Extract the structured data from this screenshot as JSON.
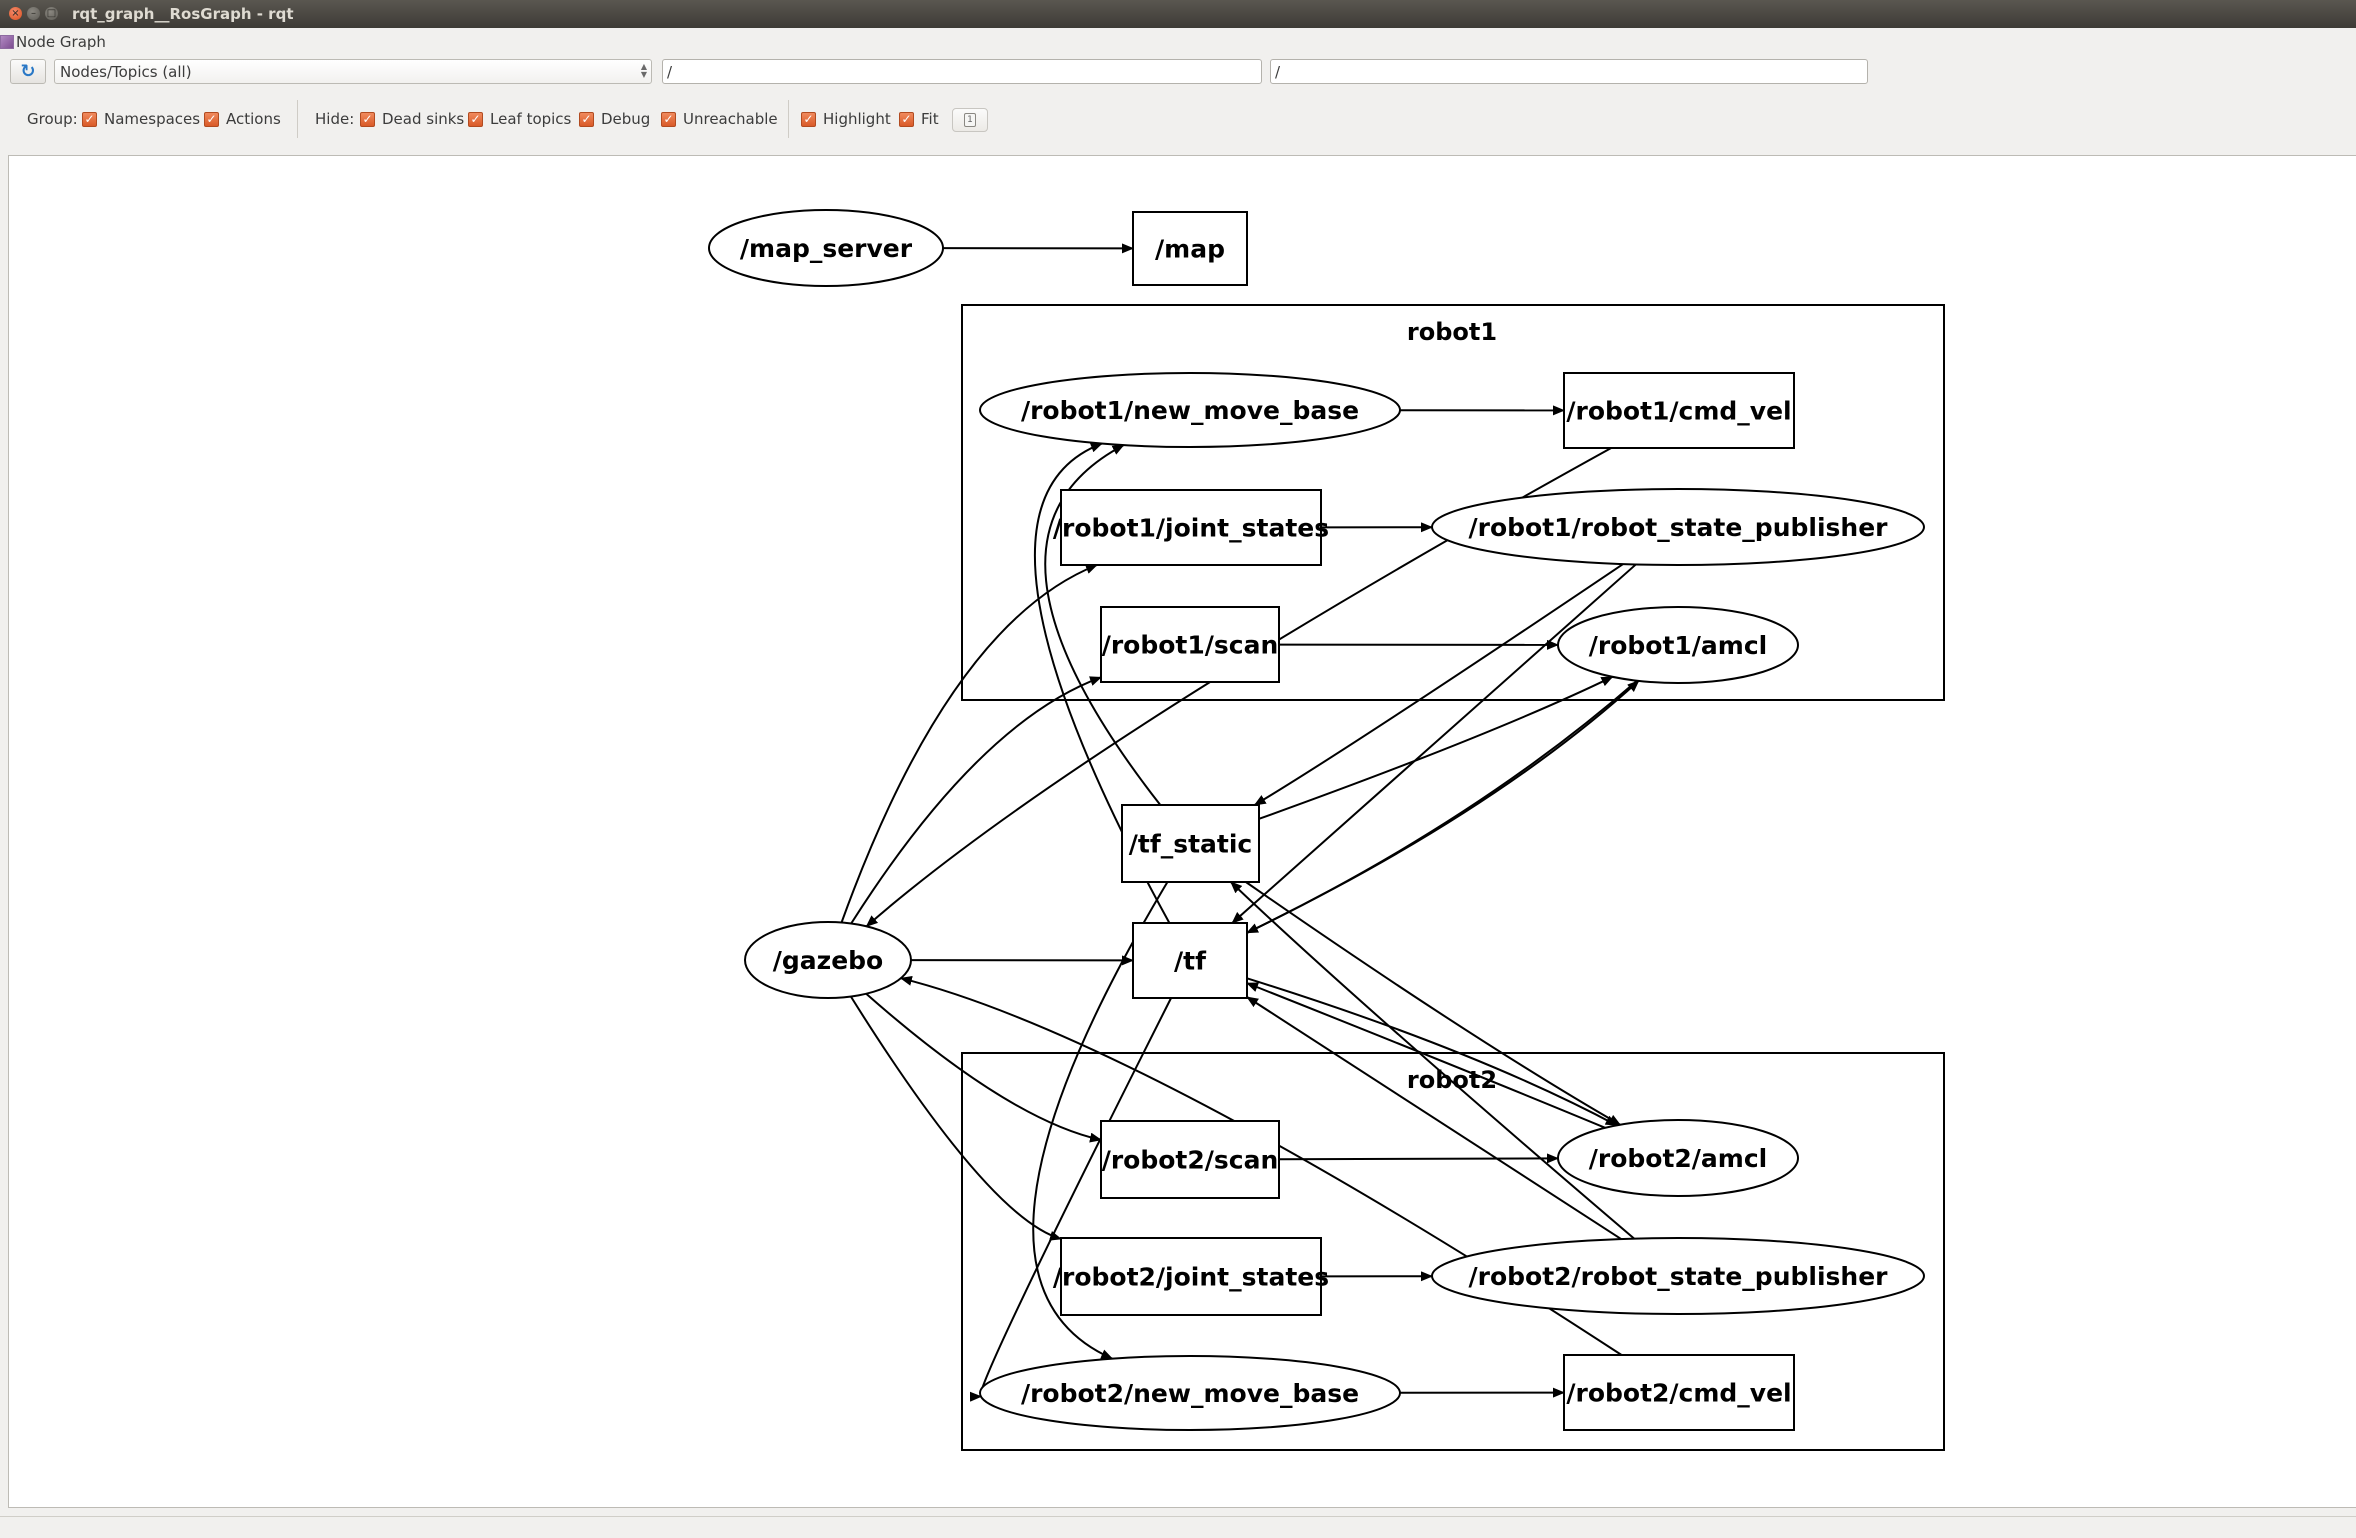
{
  "window": {
    "title": "rqt_graph__RosGraph - rqt",
    "buttons": [
      "close",
      "minimize",
      "maximize"
    ]
  },
  "plugin": {
    "title": "Node Graph",
    "icon": "node-graph-icon"
  },
  "controls": {
    "refresh_icon": "refresh-icon",
    "graph_type": "Nodes/Topics (all)",
    "namespace_filter": "/",
    "topic_filter": "/"
  },
  "options": {
    "group_label": "Group:",
    "group": [
      {
        "label": "Namespaces",
        "checked": true
      },
      {
        "label": "Actions",
        "checked": true
      }
    ],
    "hide_label": "Hide:",
    "hide": [
      {
        "label": "Dead sinks",
        "checked": true
      },
      {
        "label": "Leaf topics",
        "checked": true
      },
      {
        "label": "Debug",
        "checked": true
      },
      {
        "label": "Unreachable",
        "checked": true
      }
    ],
    "view": [
      {
        "label": "Highlight",
        "checked": true
      },
      {
        "label": "Fit",
        "checked": true
      }
    ],
    "save_icon": "save-as-image-icon"
  },
  "graph": {
    "clusters": [
      {
        "id": "robot1",
        "label": "robot1"
      },
      {
        "id": "robot2",
        "label": "robot2"
      }
    ],
    "nodes": [
      {
        "id": "map_server",
        "label": "/map_server",
        "kind": "node"
      },
      {
        "id": "map",
        "label": "/map",
        "kind": "topic"
      },
      {
        "id": "r1_nmb",
        "label": "/robot1/new_move_base",
        "kind": "node",
        "cluster": "robot1"
      },
      {
        "id": "r1_cmd",
        "label": "/robot1/cmd_vel",
        "kind": "topic",
        "cluster": "robot1"
      },
      {
        "id": "r1_js",
        "label": "/robot1/joint_states",
        "kind": "topic",
        "cluster": "robot1"
      },
      {
        "id": "r1_rsp",
        "label": "/robot1/robot_state_publisher",
        "kind": "node",
        "cluster": "robot1"
      },
      {
        "id": "r1_scan",
        "label": "/robot1/scan",
        "kind": "topic",
        "cluster": "robot1"
      },
      {
        "id": "r1_amcl",
        "label": "/robot1/amcl",
        "kind": "node",
        "cluster": "robot1"
      },
      {
        "id": "tf_static",
        "label": "/tf_static",
        "kind": "topic"
      },
      {
        "id": "tf",
        "label": "/tf",
        "kind": "topic"
      },
      {
        "id": "gazebo",
        "label": "/gazebo",
        "kind": "node"
      },
      {
        "id": "r2_scan",
        "label": "/robot2/scan",
        "kind": "topic",
        "cluster": "robot2"
      },
      {
        "id": "r2_amcl",
        "label": "/robot2/amcl",
        "kind": "node",
        "cluster": "robot2"
      },
      {
        "id": "r2_js",
        "label": "/robot2/joint_states",
        "kind": "topic",
        "cluster": "robot2"
      },
      {
        "id": "r2_rsp",
        "label": "/robot2/robot_state_publisher",
        "kind": "node",
        "cluster": "robot2"
      },
      {
        "id": "r2_nmb",
        "label": "/robot2/new_move_base",
        "kind": "node",
        "cluster": "robot2"
      },
      {
        "id": "r2_cmd",
        "label": "/robot2/cmd_vel",
        "kind": "topic",
        "cluster": "robot2"
      }
    ],
    "edges": [
      {
        "from": "map_server",
        "to": "map"
      },
      {
        "from": "r1_nmb",
        "to": "r1_cmd"
      },
      {
        "from": "r1_js",
        "to": "r1_rsp"
      },
      {
        "from": "r1_scan",
        "to": "r1_amcl"
      },
      {
        "from": "gazebo",
        "to": "r1_js"
      },
      {
        "from": "gazebo",
        "to": "r1_scan"
      },
      {
        "from": "gazebo",
        "to": "tf"
      },
      {
        "from": "gazebo",
        "to": "r2_scan"
      },
      {
        "from": "gazebo",
        "to": "r2_js"
      },
      {
        "from": "r1_cmd",
        "to": "gazebo"
      },
      {
        "from": "r2_cmd",
        "to": "gazebo"
      },
      {
        "from": "tf_static",
        "to": "r1_nmb"
      },
      {
        "from": "tf_static",
        "to": "r1_amcl"
      },
      {
        "from": "tf_static",
        "to": "r2_amcl"
      },
      {
        "from": "tf_static",
        "to": "r2_nmb"
      },
      {
        "from": "tf",
        "to": "r1_nmb"
      },
      {
        "from": "tf",
        "to": "r1_amcl"
      },
      {
        "from": "tf",
        "to": "r2_amcl"
      },
      {
        "from": "tf",
        "to": "r2_nmb"
      },
      {
        "from": "r1_rsp",
        "to": "tf_static"
      },
      {
        "from": "r1_rsp",
        "to": "tf"
      },
      {
        "from": "r1_amcl",
        "to": "tf"
      },
      {
        "from": "r2_rsp",
        "to": "tf_static"
      },
      {
        "from": "r2_rsp",
        "to": "tf"
      },
      {
        "from": "r2_amcl",
        "to": "tf"
      },
      {
        "from": "r2_scan",
        "to": "r2_amcl"
      },
      {
        "from": "r2_js",
        "to": "r2_rsp"
      },
      {
        "from": "r2_nmb",
        "to": "r2_cmd"
      }
    ]
  }
}
